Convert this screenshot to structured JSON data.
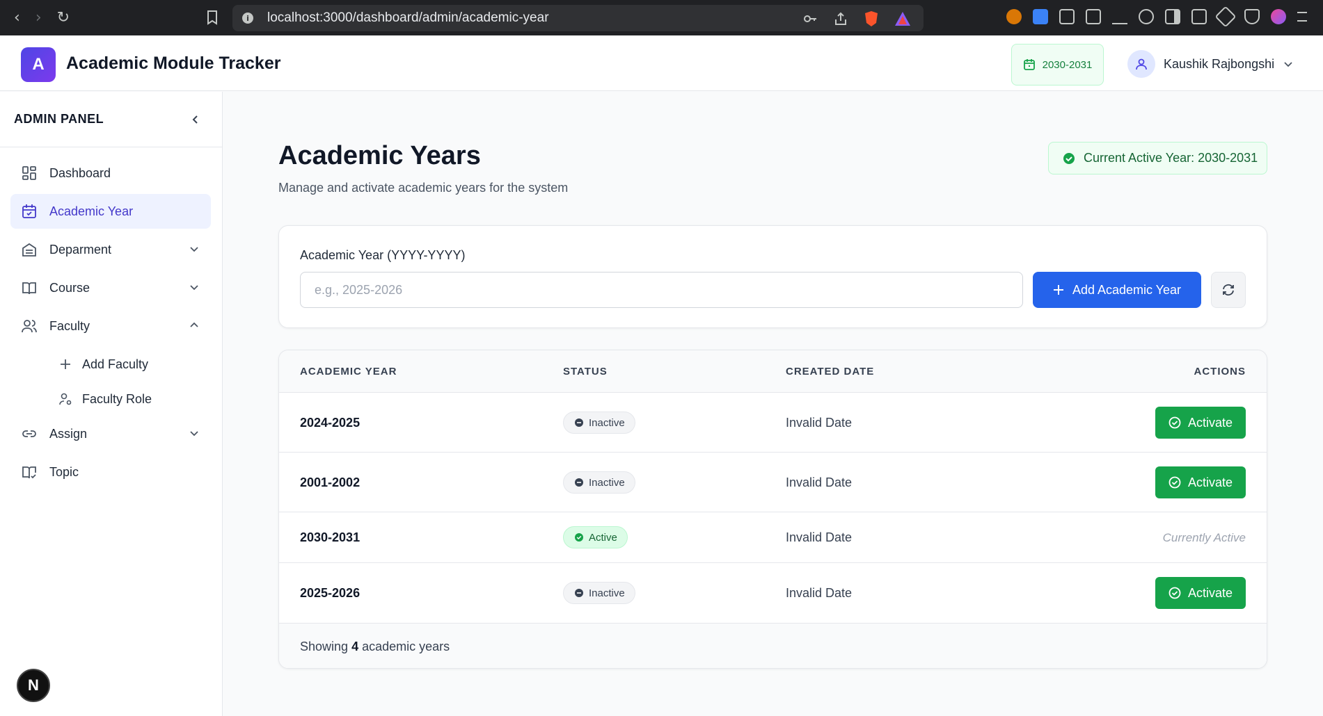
{
  "browser": {
    "url": "localhost:3000/dashboard/admin/academic-year"
  },
  "header": {
    "logo_letter": "A",
    "title": "Academic Module Tracker",
    "year_chip": "2030-2031",
    "user_name": "Kaushik Rajbongshi"
  },
  "sidebar": {
    "title": "ADMIN PANEL",
    "items": [
      {
        "label": "Dashboard",
        "icon": "grid-icon"
      },
      {
        "label": "Academic Year",
        "icon": "calendar-icon",
        "active": true
      },
      {
        "label": "Deparment",
        "icon": "building-icon",
        "expandable": true
      },
      {
        "label": "Course",
        "icon": "book-icon",
        "expandable": true
      },
      {
        "label": "Faculty",
        "icon": "users-icon",
        "expanded": true
      },
      {
        "label": "Assign",
        "icon": "link-icon",
        "expandable": true
      },
      {
        "label": "Topic",
        "icon": "book-check-icon"
      }
    ],
    "faculty_sub": [
      {
        "label": "Add Faculty",
        "icon": "plus-icon"
      },
      {
        "label": "Faculty Role",
        "icon": "user-cog-icon"
      }
    ],
    "next_badge": "N"
  },
  "main": {
    "title": "Academic Years",
    "subtitle": "Manage and activate academic years for the system",
    "active_banner": "Current Active Year: 2030-2031",
    "form": {
      "label": "Academic Year (YYYY-YYYY)",
      "placeholder": "e.g., 2025-2026",
      "value": "",
      "add_button": "Add Academic Year"
    },
    "table": {
      "headers": [
        "ACADEMIC YEAR",
        "STATUS",
        "CREATED DATE",
        "ACTIONS"
      ],
      "rows": [
        {
          "year": "2024-2025",
          "status": "Inactive",
          "created": "Invalid Date",
          "action": "Activate"
        },
        {
          "year": "2001-2002",
          "status": "Inactive",
          "created": "Invalid Date",
          "action": "Activate"
        },
        {
          "year": "2030-2031",
          "status": "Active",
          "created": "Invalid Date",
          "action": "Currently Active"
        },
        {
          "year": "2025-2026",
          "status": "Inactive",
          "created": "Invalid Date",
          "action": "Activate"
        }
      ],
      "footer_prefix": "Showing",
      "footer_count": "4",
      "footer_suffix": "academic years"
    }
  },
  "colors": {
    "primary": "#2563eb",
    "success": "#16a34a",
    "accent": "#4f46e5"
  }
}
